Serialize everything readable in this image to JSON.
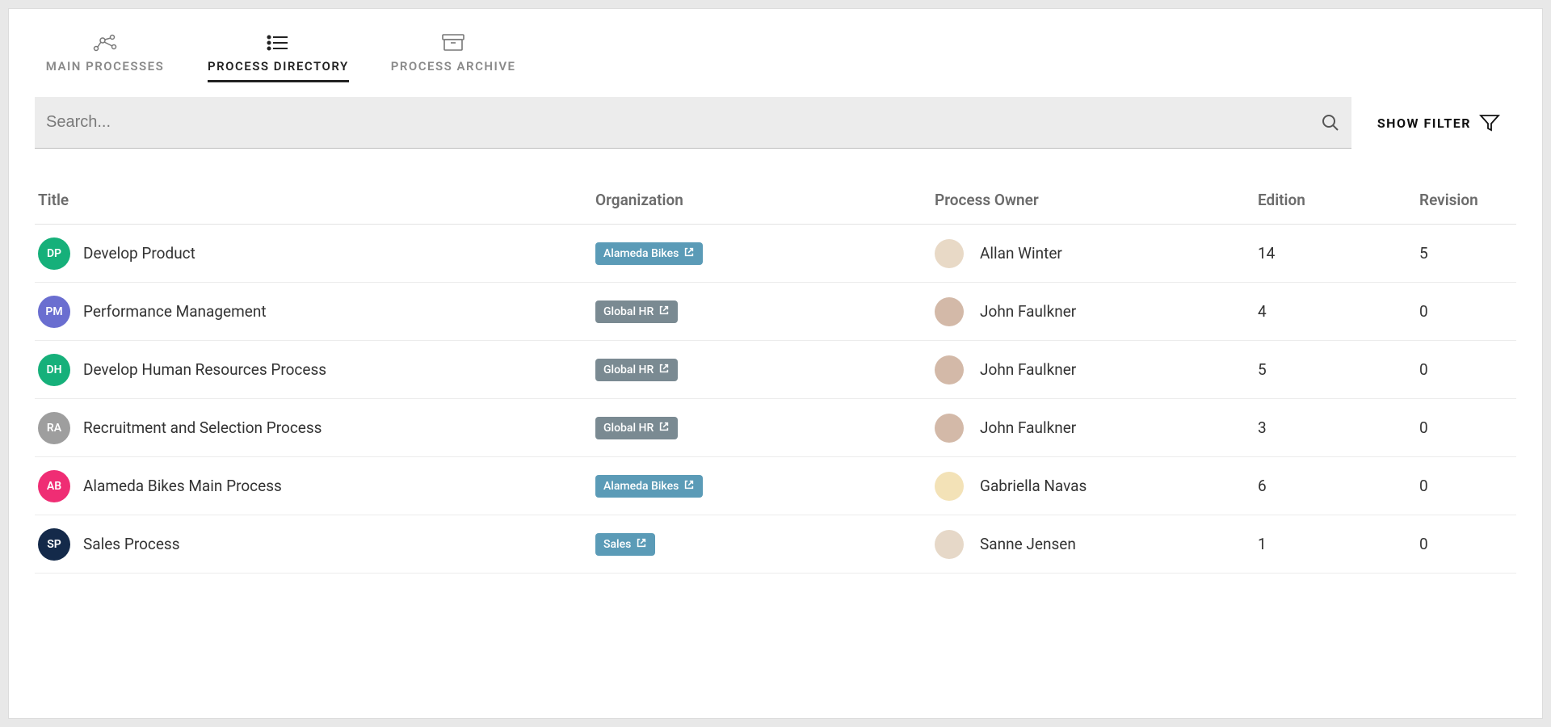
{
  "tabs": [
    {
      "label": "MAIN PROCESSES",
      "active": false
    },
    {
      "label": "PROCESS DIRECTORY",
      "active": true
    },
    {
      "label": "PROCESS ARCHIVE",
      "active": false
    }
  ],
  "search": {
    "placeholder": "Search...",
    "value": ""
  },
  "filter_button": "SHOW FILTER",
  "columns": {
    "title": "Title",
    "organization": "Organization",
    "owner": "Process Owner",
    "edition": "Edition",
    "revision": "Revision"
  },
  "rows": [
    {
      "initials": "DP",
      "badge_color": "#16b07a",
      "title": "Develop Product",
      "org": "Alameda Bikes",
      "org_style": "blue",
      "owner": "Allan Winter",
      "avatar_bg": "#e8d9c6",
      "edition": "14",
      "revision": "5"
    },
    {
      "initials": "PM",
      "badge_color": "#6a6ed0",
      "title": "Performance Management",
      "org": "Global HR",
      "org_style": "gray",
      "owner": "John Faulkner",
      "avatar_bg": "#d3b9a8",
      "edition": "4",
      "revision": "0"
    },
    {
      "initials": "DH",
      "badge_color": "#16b07a",
      "title": "Develop Human Resources Process",
      "org": "Global HR",
      "org_style": "gray",
      "owner": "John Faulkner",
      "avatar_bg": "#d3b9a8",
      "edition": "5",
      "revision": "0"
    },
    {
      "initials": "RA",
      "badge_color": "#9e9e9e",
      "title": "Recruitment and Selection Process",
      "org": "Global HR",
      "org_style": "gray",
      "owner": "John Faulkner",
      "avatar_bg": "#d3b9a8",
      "edition": "3",
      "revision": "0"
    },
    {
      "initials": "AB",
      "badge_color": "#ef2d74",
      "title": "Alameda Bikes Main Process",
      "org": "Alameda Bikes",
      "org_style": "blue",
      "owner": "Gabriella Navas",
      "avatar_bg": "#f3e2b7",
      "edition": "6",
      "revision": "0"
    },
    {
      "initials": "SP",
      "badge_color": "#142a4a",
      "title": "Sales Process",
      "org": "Sales",
      "org_style": "blue",
      "owner": "Sanne Jensen",
      "avatar_bg": "#e6d8c8",
      "edition": "1",
      "revision": "0"
    }
  ]
}
